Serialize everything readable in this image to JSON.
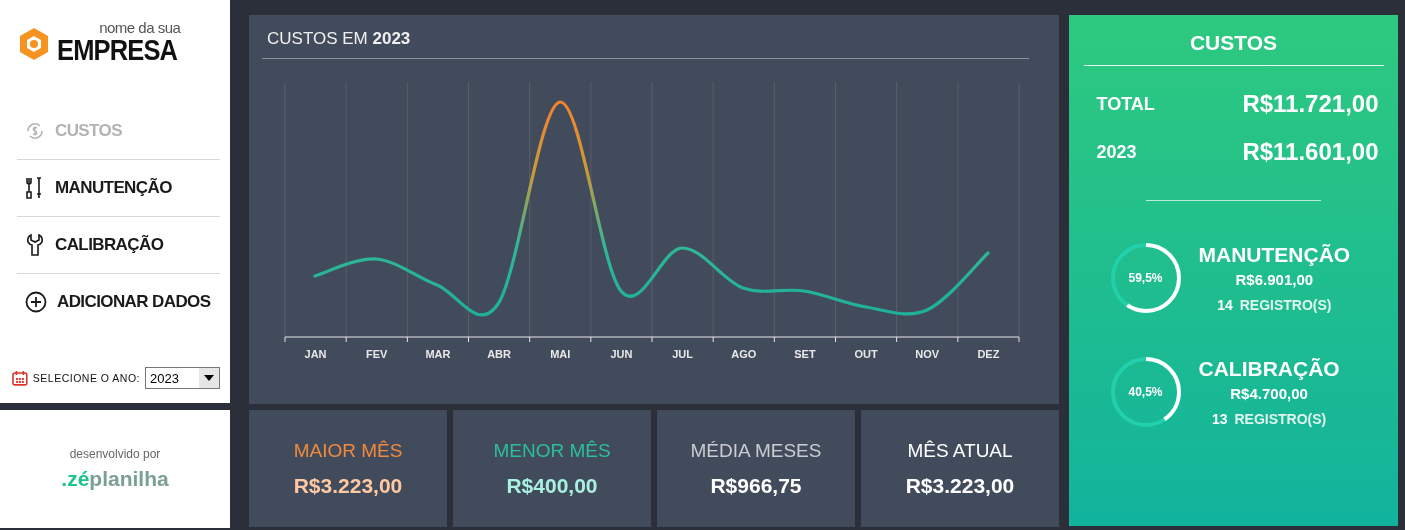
{
  "sidebar": {
    "logo": {
      "tagline": "nome da sua",
      "name": "EMPRESA"
    },
    "nav": [
      {
        "label": "CUSTOS",
        "kind": "costs",
        "selected": true
      },
      {
        "label": "MANUTENÇÃO",
        "kind": "tools",
        "selected": false
      },
      {
        "label": "CALIBRAÇÃO",
        "kind": "wrench",
        "selected": false
      },
      {
        "label": "ADICIONAR DADOS",
        "kind": "add",
        "selected": false
      }
    ],
    "year_select": {
      "label": "SELECIONE O ANO:",
      "value": "2023"
    },
    "credit": {
      "caption": "desenvolvido por",
      "brand_prefix": ".zé",
      "brand": "planilha"
    }
  },
  "chart": {
    "title": "CUSTOS EM **2023**",
    "months": [
      "JAN",
      "FEV",
      "MAR",
      "ABR",
      "MAI",
      "JUN",
      "JUL",
      "AGO",
      "SET",
      "OUT",
      "NOV",
      "DEZ"
    ]
  },
  "cards": [
    {
      "label": "MAIOR MÊS",
      "value": "R$3.223,00",
      "kind": "max"
    },
    {
      "label": "MENOR MÊS",
      "value": "R$400,00",
      "kind": "min"
    },
    {
      "label": "MÉDIA MESES",
      "value": "R$966,75",
      "kind": "avg"
    },
    {
      "label": "MÊS ATUAL",
      "value": "R$3.223,00",
      "kind": "current"
    }
  ],
  "summary": {
    "title": "CUSTOS",
    "totals": [
      {
        "label": "TOTAL",
        "value": "R$11.721,00"
      },
      {
        "label": "2023",
        "value": "R$11.601,00"
      }
    ],
    "categories": [
      {
        "percent": "59,5%",
        "level": 0.595,
        "name": "MANUTENÇÃO",
        "value": "R$6.901,00",
        "count": "14",
        "count_label": "REGISTRO(S)"
      },
      {
        "percent": "40,5%",
        "level": 0.405,
        "name": "CALIBRAÇÃO",
        "value": "R$4.700,00",
        "count": "13",
        "count_label": "REGISTRO(S)"
      }
    ]
  }
}
